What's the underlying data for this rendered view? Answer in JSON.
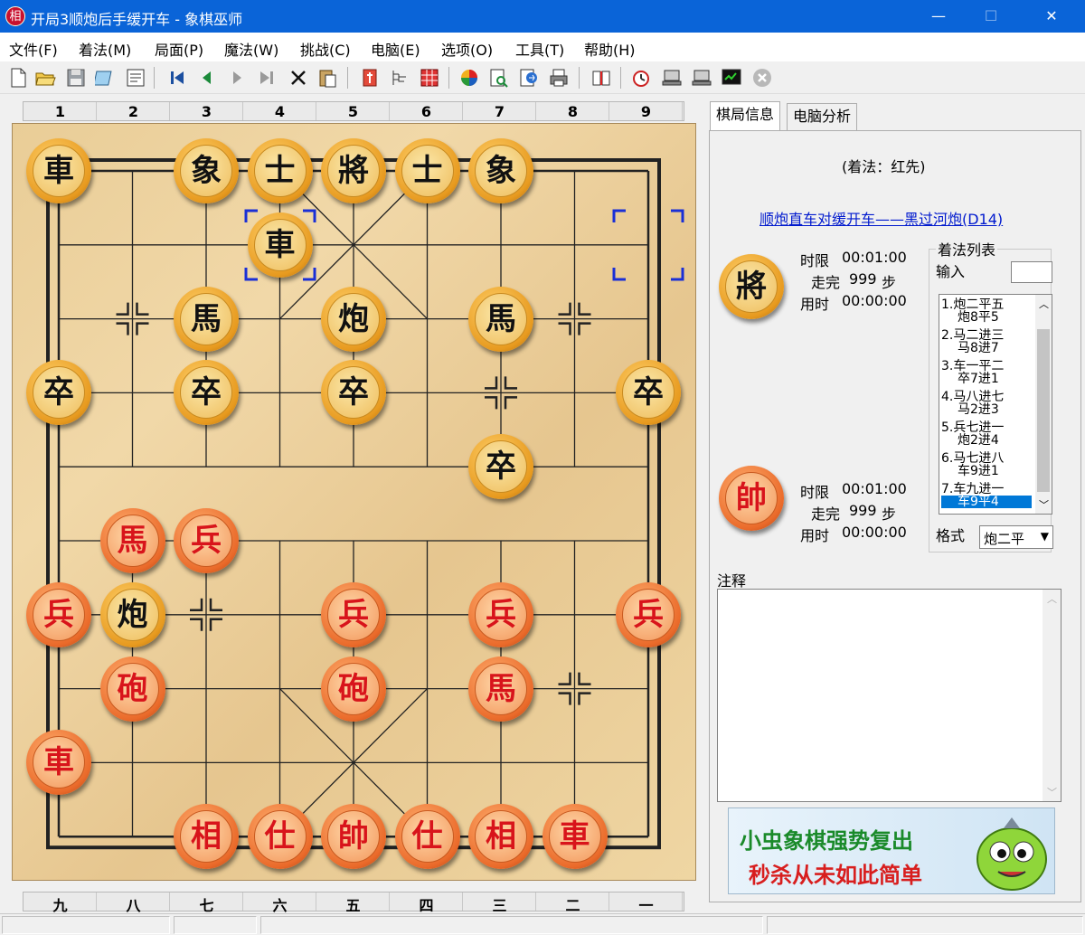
{
  "window": {
    "app_icon": "相",
    "title": "开局3顺炮后手缓开车 - 象棋巫师",
    "minimize": "—",
    "maximize": "☐",
    "close": "✕"
  },
  "menu": [
    "文件(F)",
    "着法(M)",
    "局面(P)",
    "魔法(W)",
    "挑战(C)",
    "电脑(E)",
    "选项(O)",
    "工具(T)",
    "帮助(H)"
  ],
  "toolbar_icons": [
    "new-file-icon",
    "open-folder-icon",
    "save-icon",
    "edit-icon",
    "properties-icon",
    "first-move-icon",
    "previous-move-icon",
    "next-move-icon",
    "last-move-icon",
    "delete-icon",
    "paste-icon",
    "flip-board-icon",
    "tree-icon",
    "spreadsheet-icon",
    "engine-icon",
    "search-icon",
    "export-icon",
    "print-icon",
    "book-icon",
    "clock-icon",
    "computer-red-icon",
    "computer-black-icon",
    "monitor-icon",
    "stop-icon"
  ],
  "board": {
    "top_coords": [
      "1",
      "2",
      "3",
      "4",
      "5",
      "6",
      "7",
      "8",
      "9"
    ],
    "bottom_coords": [
      "九",
      "八",
      "七",
      "六",
      "五",
      "四",
      "三",
      "二",
      "一"
    ],
    "pieces": [
      {
        "ch": "車",
        "side": "black",
        "col": 0,
        "row": 0
      },
      {
        "ch": "象",
        "side": "black",
        "col": 2,
        "row": 0
      },
      {
        "ch": "士",
        "side": "black",
        "col": 3,
        "row": 0
      },
      {
        "ch": "將",
        "side": "black",
        "col": 4,
        "row": 0
      },
      {
        "ch": "士",
        "side": "black",
        "col": 5,
        "row": 0
      },
      {
        "ch": "象",
        "side": "black",
        "col": 6,
        "row": 0
      },
      {
        "ch": "車",
        "side": "black",
        "col": 3,
        "row": 1
      },
      {
        "ch": "馬",
        "side": "black",
        "col": 2,
        "row": 2
      },
      {
        "ch": "炮",
        "side": "black",
        "col": 4,
        "row": 2
      },
      {
        "ch": "馬",
        "side": "black",
        "col": 6,
        "row": 2
      },
      {
        "ch": "卒",
        "side": "black",
        "col": 0,
        "row": 3
      },
      {
        "ch": "卒",
        "side": "black",
        "col": 2,
        "row": 3
      },
      {
        "ch": "卒",
        "side": "black",
        "col": 4,
        "row": 3
      },
      {
        "ch": "卒",
        "side": "black",
        "col": 8,
        "row": 3
      },
      {
        "ch": "卒",
        "side": "black",
        "col": 6,
        "row": 4
      },
      {
        "ch": "馬",
        "side": "red",
        "col": 1,
        "row": 5
      },
      {
        "ch": "兵",
        "side": "red",
        "col": 2,
        "row": 5
      },
      {
        "ch": "兵",
        "side": "red",
        "col": 0,
        "row": 6
      },
      {
        "ch": "炮",
        "side": "black",
        "col": 1,
        "row": 6
      },
      {
        "ch": "兵",
        "side": "red",
        "col": 4,
        "row": 6
      },
      {
        "ch": "兵",
        "side": "red",
        "col": 6,
        "row": 6
      },
      {
        "ch": "兵",
        "side": "red",
        "col": 8,
        "row": 6
      },
      {
        "ch": "砲",
        "side": "red",
        "col": 1,
        "row": 7
      },
      {
        "ch": "砲",
        "side": "red",
        "col": 4,
        "row": 7
      },
      {
        "ch": "馬",
        "side": "red",
        "col": 6,
        "row": 7
      },
      {
        "ch": "車",
        "side": "red",
        "col": 0,
        "row": 8
      },
      {
        "ch": "相",
        "side": "red",
        "col": 2,
        "row": 9
      },
      {
        "ch": "仕",
        "side": "red",
        "col": 3,
        "row": 9
      },
      {
        "ch": "帥",
        "side": "red",
        "col": 4,
        "row": 9
      },
      {
        "ch": "仕",
        "side": "red",
        "col": 5,
        "row": 9
      },
      {
        "ch": "相",
        "side": "red",
        "col": 6,
        "row": 9
      },
      {
        "ch": "車",
        "side": "red",
        "col": 7,
        "row": 9
      }
    ],
    "move_markers": [
      {
        "col": 3,
        "row": 1
      },
      {
        "col": 8,
        "row": 1
      }
    ]
  },
  "panel": {
    "tabs": [
      "棋局信息",
      "电脑分析"
    ],
    "turn_text": "(着法：红先)",
    "opening_link": "顺炮直车对缓开车——黑过河炮(D14)",
    "black_piece": "將",
    "red_piece": "帥",
    "black_clock": {
      "limit_label": "时限",
      "limit": "00:01:00",
      "moves_label": "走完",
      "moves": "999",
      "moves_unit": "步",
      "used_label": "用时",
      "used": "00:00:00"
    },
    "red_clock": {
      "limit_label": "时限",
      "limit": "00:01:00",
      "moves_label": "走完",
      "moves": "999",
      "moves_unit": "步",
      "used_label": "用时",
      "used": "00:00:00"
    },
    "movelist_title": "着法列表",
    "input_label": "输入",
    "moves": [
      {
        "num": "1.",
        "red": "炮二平五",
        "black": "炮8平5"
      },
      {
        "num": "2.",
        "red": "马二进三",
        "black": "马8进7"
      },
      {
        "num": "3.",
        "red": "车一平二",
        "black": "卒7进1"
      },
      {
        "num": "4.",
        "red": "马八进七",
        "black": "马2进3"
      },
      {
        "num": "5.",
        "red": "兵七进一",
        "black": "炮2进4"
      },
      {
        "num": "6.",
        "red": "马七进八",
        "black": "车9进1"
      },
      {
        "num": "7.",
        "red": "车九进一",
        "black": "车9平4"
      }
    ],
    "format_label": "格式",
    "format_value": "炮二平",
    "notes_label": "注释",
    "ad_line1": "小虫象棋强势复出",
    "ad_line2": "秒杀从未如此简单"
  }
}
